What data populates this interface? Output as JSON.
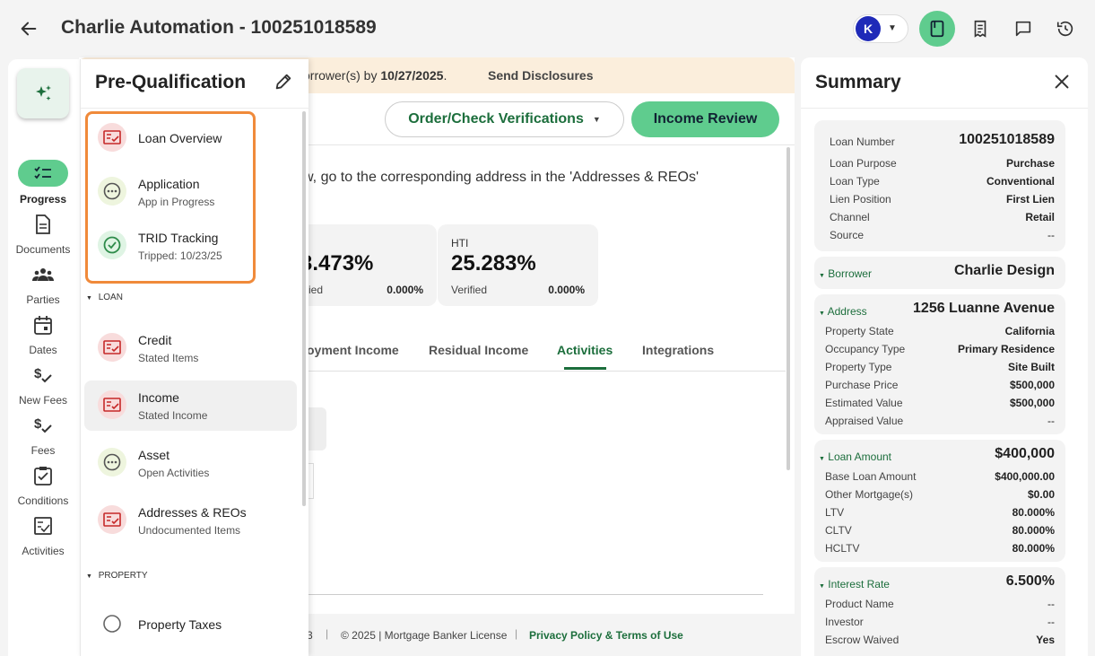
{
  "header": {
    "title": "Charlie Automation - 100251018589",
    "user_initial": "K"
  },
  "main": {
    "banner_text_prefix": "orrower(s) by ",
    "banner_date": "10/27/2025",
    "banner_suffix": ".",
    "banner_link": "Send Disclosures",
    "order_btn": "Order/Check Verifications",
    "income_review_btn": "Income Review",
    "instruction": "w, go to the corresponding address in the 'Addresses & REOs'",
    "cards": [
      {
        "label": "",
        "value": "3.473%",
        "sub": "ified",
        "sub_value": "0.000%"
      },
      {
        "label": "HTI",
        "value": "25.283%",
        "sub": "Verified",
        "sub_value": "0.000%"
      }
    ],
    "tabs": [
      "oyment Income",
      "Residual Income",
      "Activities",
      "Integrations"
    ],
    "footer": {
      "version": "3",
      "copyright": "© 2025 | Mortgage Banker License",
      "link": "Privacy Policy & Terms of Use"
    }
  },
  "rail": {
    "items": [
      {
        "label": "Progress",
        "icon": "checklist-icon"
      },
      {
        "label": "Documents",
        "icon": "document-icon"
      },
      {
        "label": "Parties",
        "icon": "people-icon"
      },
      {
        "label": "Dates",
        "icon": "calendar-icon"
      },
      {
        "label": "New Fees",
        "icon": "dollar-check-icon"
      },
      {
        "label": "Fees",
        "icon": "dollar-check-icon"
      },
      {
        "label": "Conditions",
        "icon": "clipboard-check-icon"
      },
      {
        "label": "Activities",
        "icon": "activity-icon"
      }
    ]
  },
  "panel": {
    "title": "Pre-Qualification",
    "items_top": [
      {
        "label": "Loan Overview",
        "sub": "",
        "icon": "red"
      },
      {
        "label": "Application",
        "sub": "App in Progress",
        "icon": "olive"
      },
      {
        "label": "TRID Tracking",
        "sub": "Tripped: 10/23/25",
        "icon": "green"
      }
    ],
    "section_loan": "LOAN",
    "items_loan": [
      {
        "label": "Credit",
        "sub": "Stated Items",
        "icon": "red"
      },
      {
        "label": "Income",
        "sub": "Stated Income",
        "icon": "red"
      },
      {
        "label": "Asset",
        "sub": "Open Activities",
        "icon": "olive"
      },
      {
        "label": "Addresses & REOs",
        "sub": "Undocumented Items",
        "icon": "red"
      }
    ],
    "section_property": "PROPERTY",
    "items_property": [
      {
        "label": "Property Taxes",
        "sub": "",
        "icon": "plain"
      }
    ]
  },
  "summary": {
    "title": "Summary",
    "loan_card": [
      {
        "k": "Loan Number",
        "v": "100251018589"
      },
      {
        "k": "Loan Purpose",
        "v": "Purchase"
      },
      {
        "k": "Loan Type",
        "v": "Conventional"
      },
      {
        "k": "Lien Position",
        "v": "First Lien"
      },
      {
        "k": "Channel",
        "v": "Retail"
      },
      {
        "k": "Source",
        "v": "--"
      }
    ],
    "borrower": {
      "k": "Borrower",
      "v": "Charlie Design"
    },
    "address": {
      "k": "Address",
      "v": "1256 Luanne Avenue",
      "rows": [
        {
          "k": "Property State",
          "v": "California"
        },
        {
          "k": "Occupancy Type",
          "v": "Primary Residence"
        },
        {
          "k": "Property Type",
          "v": "Site Built"
        },
        {
          "k": "Purchase Price",
          "v": "$500,000"
        },
        {
          "k": "Estimated Value",
          "v": "$500,000"
        },
        {
          "k": "Appraised Value",
          "v": "--"
        }
      ]
    },
    "loan_amount": {
      "k": "Loan Amount",
      "v": "$400,000",
      "rows": [
        {
          "k": "Base Loan Amount",
          "v": "$400,000.00"
        },
        {
          "k": "Other Mortgage(s)",
          "v": "$0.00"
        },
        {
          "k": "LTV",
          "v": "80.000%"
        },
        {
          "k": "CLTV",
          "v": "80.000%"
        },
        {
          "k": "HCLTV",
          "v": "80.000%"
        }
      ]
    },
    "interest_rate": {
      "k": "Interest Rate",
      "v": "6.500%",
      "rows": [
        {
          "k": "Product Name",
          "v": "--"
        },
        {
          "k": "Investor",
          "v": "--"
        },
        {
          "k": "Escrow Waived",
          "v": "Yes"
        }
      ]
    }
  },
  "colors": {
    "accent": "#5fcc8e",
    "brand_green": "#1c6e3c",
    "highlight": "#f08a3a",
    "avatar": "#1f2ab8"
  }
}
